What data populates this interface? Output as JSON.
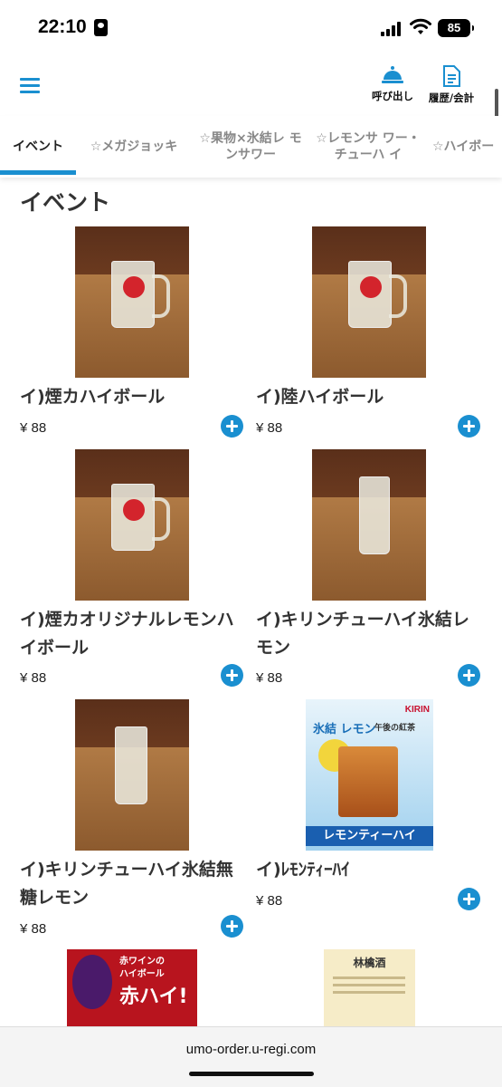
{
  "status_bar": {
    "time": "22:10",
    "battery": "85"
  },
  "header": {
    "call_label": "呼び出し",
    "history_label": "履歴/会計"
  },
  "tabs": [
    {
      "label": "イベント"
    },
    {
      "label": "☆メガジョッキ"
    },
    {
      "label": "☆果物×氷結レ モンサワー"
    },
    {
      "label": "☆レモンサ ワー・チューハ イ"
    },
    {
      "label": "☆ハイボー"
    }
  ],
  "section_title": "イベント",
  "products": [
    {
      "name": "イ)煙カハイボール",
      "price": "¥ 88"
    },
    {
      "name": "イ)陸ハイボール",
      "price": "¥ 88"
    },
    {
      "name": "イ)煙カオリジナルレモンハイボール",
      "price": "¥ 88"
    },
    {
      "name": "イ)キリンチューハイ氷結レモン",
      "price": "¥ 88"
    },
    {
      "name": "イ)キリンチューハイ氷結無糖レモン",
      "price": "¥ 88"
    },
    {
      "name": "イ)ﾚﾓﾝﾃｨｰﾊｲ",
      "price": "¥ 88"
    }
  ],
  "posters": {
    "lemon_tea": {
      "brand": "KIRIN",
      "line1": "氷結 レモン",
      "line2": "午後の紅茶",
      "line3": "レモンティーハイ"
    },
    "red_wine": {
      "line1": "赤ワインの",
      "line2": "ハイボール",
      "line3": "赤ハイ!"
    },
    "ringo": {
      "title": "林檎酒"
    }
  },
  "url": "umo-order.u-regi.com",
  "colors": {
    "accent": "#1a8fd0"
  }
}
